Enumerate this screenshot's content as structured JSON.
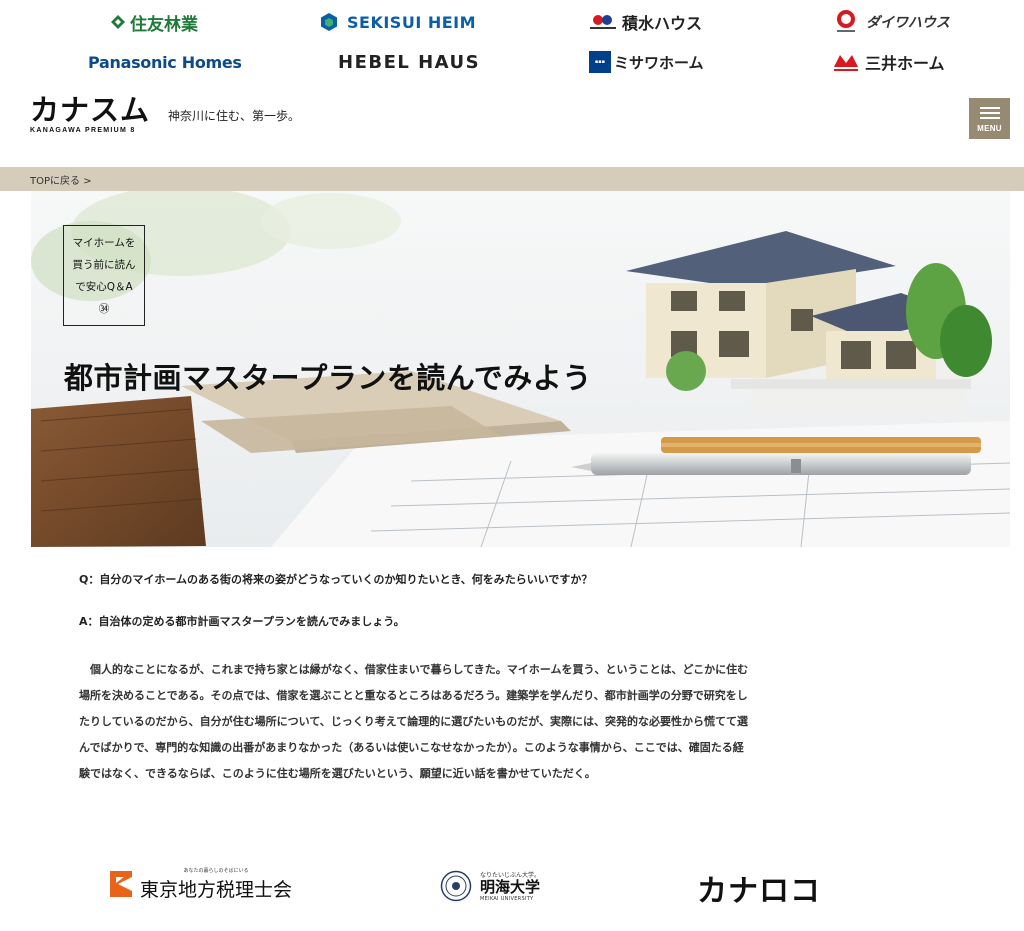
{
  "sponsors": {
    "sumitomo": "住友林業",
    "sekisui_heim": "SEKISUI HEIM",
    "sekisui_house": "積水ハウス",
    "daiwa": "ダイワハウス",
    "panasonic": "Panasonic Homes",
    "hebel": "HEBEL HAUS",
    "misawa": "ミサワホーム",
    "mitsui": "三井ホーム"
  },
  "header": {
    "brand_name": "カナスム",
    "brand_sub": "KANAGAWA PREMIUM 8",
    "tagline": "神奈川に住む、第一歩。",
    "menu_label": "MENU"
  },
  "breadcrumb": {
    "top_link": "TOPに戻る >"
  },
  "hero": {
    "series_lines": [
      "マイホームを",
      "買う前に読ん",
      "で安心Q＆A",
      "㉞"
    ],
    "title": "都市計画マスタープランを読んでみよう"
  },
  "article": {
    "question": "Q：自分のマイホームのある街の将来の姿がどうなっていくのか知りたいとき、何をみたらいいですか？",
    "answer": "A：自治体の定める都市計画マスタープランを読んでみましょう。",
    "body_lines": [
      "　個人的なことになるが、これまで持ち家とは縁がなく、借家住まいで暮らしてきた。マイホームを買う、ということは、どこかに住む",
      "場所を決めることである。その点では、借家を選ぶことと重なるところはあるだろう。建築学を学んだり、都市計画学の分野で研究をし",
      "たりしているのだから、自分が住む場所について、じっくり考えて論理的に選びたいものだが、実際には、突発的な必要性から慌てて選",
      "んでばかりで、専門的な知識の出番があまりなかった（あるいは使いこなせなかったか）。このような事情から、ここでは、確固たる経",
      "験ではなく、できるならば、このように住む場所を選びたいという、願望に近い話を書かせていただく。"
    ]
  },
  "footer_partners": {
    "tokyo_tagline": "あなたの暮らしのそばにいる",
    "tokyo_name": "東京地方税理士会",
    "meikai_tagline": "なりたいじぶん大学。",
    "meikai_name": "明海大学",
    "meikai_en": "MEIKAI UNIVERSITY",
    "kanaloco": "カナロコ"
  },
  "colors": {
    "breadcrumb_bg": "#d6ccbb",
    "menu_bg": "#978a72",
    "sekisui_heim_blue": "#0a5fa8",
    "panasonic_blue": "#0c4a8a",
    "sumitomo_green": "#1f7a3a"
  },
  "icons": [
    "sumitomo-logo-icon",
    "sekisui-heim-logo-icon",
    "sekisui-house-logo-icon",
    "daiwa-logo-icon",
    "misawa-logo-icon",
    "mitsui-logo-icon",
    "hamburger-menu-icon",
    "tokyo-tax-logo-icon",
    "meikai-seal-icon"
  ]
}
